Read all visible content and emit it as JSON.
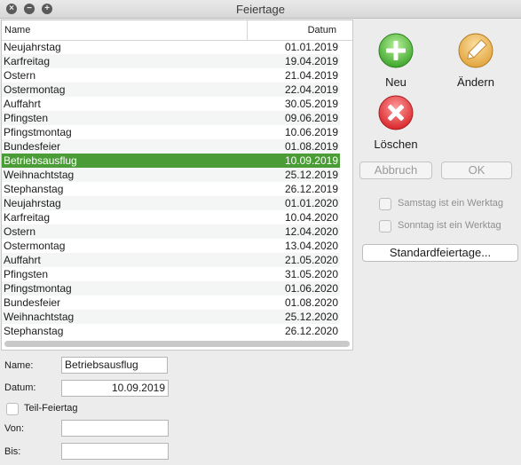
{
  "window": {
    "title": "Feiertage"
  },
  "table": {
    "col_name": "Name",
    "col_date": "Datum",
    "rows": [
      {
        "name": "Neujahrstag",
        "date": "01.01.2019"
      },
      {
        "name": "Karfreitag",
        "date": "19.04.2019"
      },
      {
        "name": "Ostern",
        "date": "21.04.2019"
      },
      {
        "name": "Ostermontag",
        "date": "22.04.2019"
      },
      {
        "name": "Auffahrt",
        "date": "30.05.2019"
      },
      {
        "name": "Pfingsten",
        "date": "09.06.2019"
      },
      {
        "name": "Pfingstmontag",
        "date": "10.06.2019"
      },
      {
        "name": "Bundesfeier",
        "date": "01.08.2019"
      },
      {
        "name": "Betriebsausflug",
        "date": "10.09.2019"
      },
      {
        "name": "Weihnachtstag",
        "date": "25.12.2019"
      },
      {
        "name": "Stephanstag",
        "date": "26.12.2019"
      },
      {
        "name": "Neujahrstag",
        "date": "01.01.2020"
      },
      {
        "name": "Karfreitag",
        "date": "10.04.2020"
      },
      {
        "name": "Ostern",
        "date": "12.04.2020"
      },
      {
        "name": "Ostermontag",
        "date": "13.04.2020"
      },
      {
        "name": "Auffahrt",
        "date": "21.05.2020"
      },
      {
        "name": "Pfingsten",
        "date": "31.05.2020"
      },
      {
        "name": "Pfingstmontag",
        "date": "01.06.2020"
      },
      {
        "name": "Bundesfeier",
        "date": "01.08.2020"
      },
      {
        "name": "Weihnachtstag",
        "date": "25.12.2020"
      },
      {
        "name": "Stephanstag",
        "date": "26.12.2020"
      }
    ],
    "selected_index": 8,
    "selected_color": "#4a9c36"
  },
  "actions": {
    "new_label": "Neu",
    "edit_label": "Ändern",
    "delete_label": "Löschen",
    "new_icon": "plus-icon",
    "edit_icon": "pencil-icon",
    "delete_icon": "x-icon",
    "cancel_label": "Abbruch",
    "ok_label": "OK",
    "saturday_label": "Samstag ist ein Werktag",
    "sunday_label": "Sonntag ist ein Werktag",
    "defaults_label": "Standardfeiertage..."
  },
  "form": {
    "name_label": "Name:",
    "name_value": "Betriebsausflug",
    "date_label": "Datum:",
    "date_value": "10.09.2019",
    "partial_label": "Teil-Feiertag",
    "from_label": "Von:",
    "from_value": "",
    "to_label": "Bis:",
    "to_value": ""
  }
}
